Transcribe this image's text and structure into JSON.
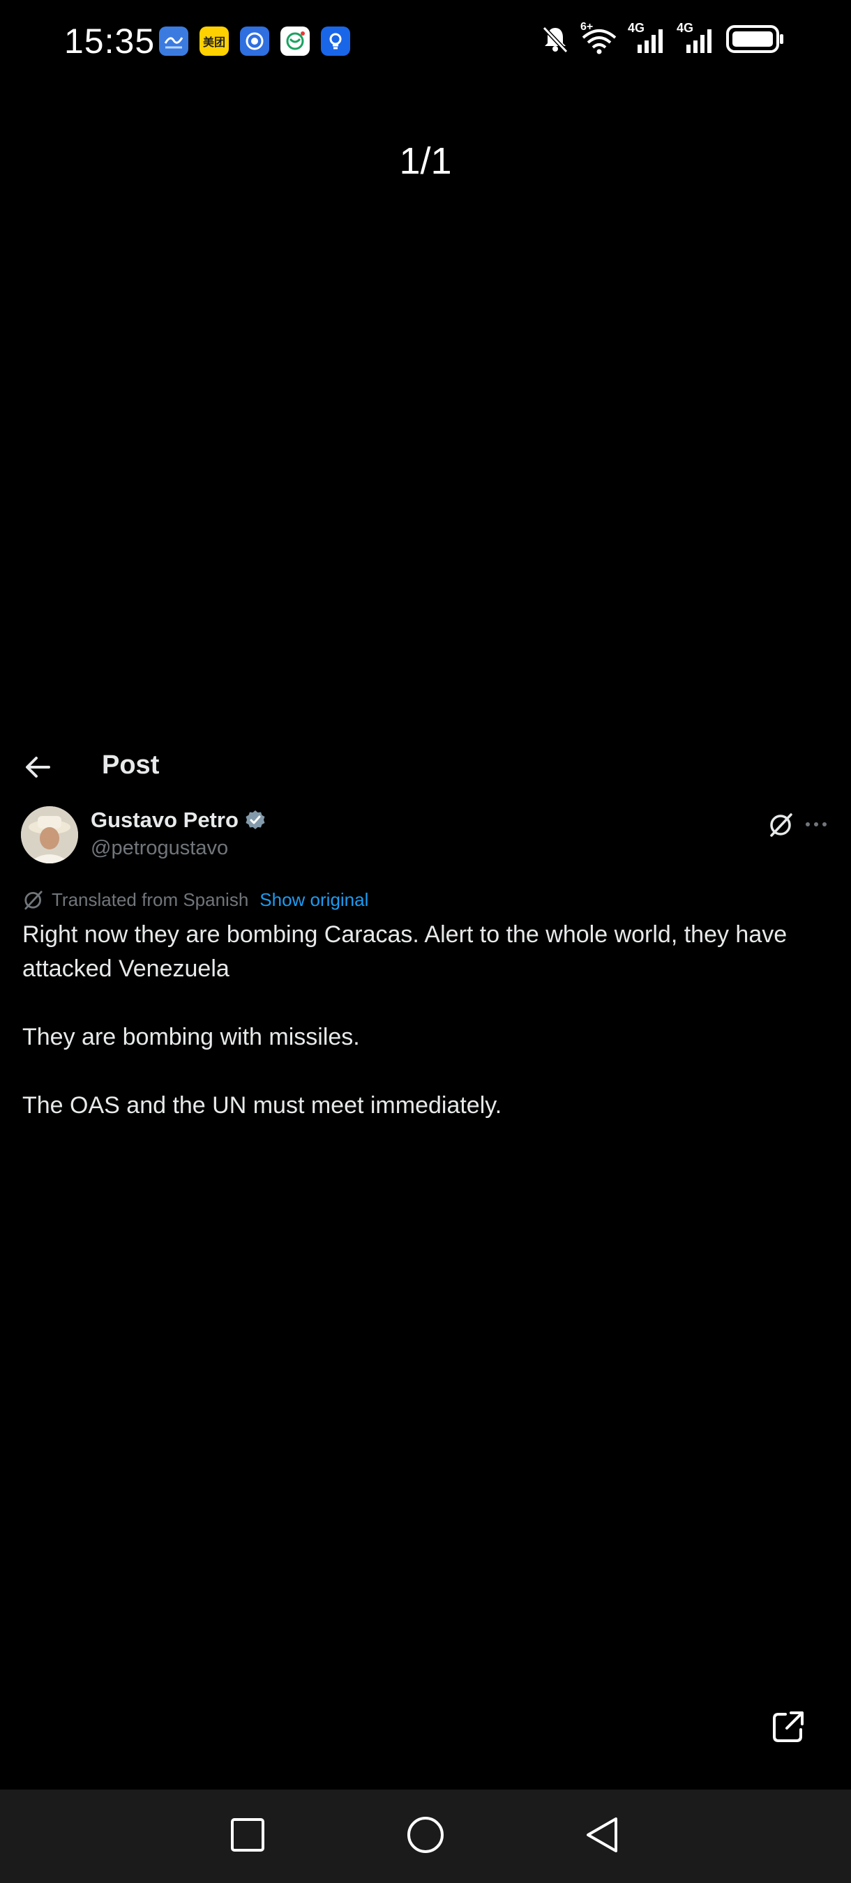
{
  "status_bar": {
    "time": "15:35",
    "apps": [
      {
        "name": "weather-app-icon",
        "label": "",
        "bg": "#3b7be0"
      },
      {
        "name": "meituan-app-icon",
        "label": "美团",
        "bg": "#ffd100"
      },
      {
        "name": "blue-app-icon",
        "label": "",
        "bg": "#2f6fe0"
      },
      {
        "name": "china-mobile-app-icon",
        "label": "",
        "bg": "#ffffff"
      },
      {
        "name": "bulb-app-icon",
        "label": "",
        "bg": "#1a66e8"
      }
    ],
    "wifi_label": "6+",
    "sim1_label": "4G",
    "sim2_label": "4G"
  },
  "viewer": {
    "counter": "1/1"
  },
  "post": {
    "header_title": "Post",
    "author_name": "Gustavo Petro",
    "author_handle": "@petrogustavo",
    "translated_label": "Translated from Spanish",
    "show_original": "Show original",
    "paragraphs": [
      "Right now they are bombing Caracas. Alert to the whole world, they have attacked Venezuela",
      "They are bombing with missiles.",
      "The OAS and the UN must meet immediately."
    ]
  },
  "colors": {
    "background": "#000000",
    "text": "#e7e9ea",
    "secondary": "#71767b",
    "accent": "#1d9bf0",
    "nav_bar": "#1b1b1b"
  }
}
